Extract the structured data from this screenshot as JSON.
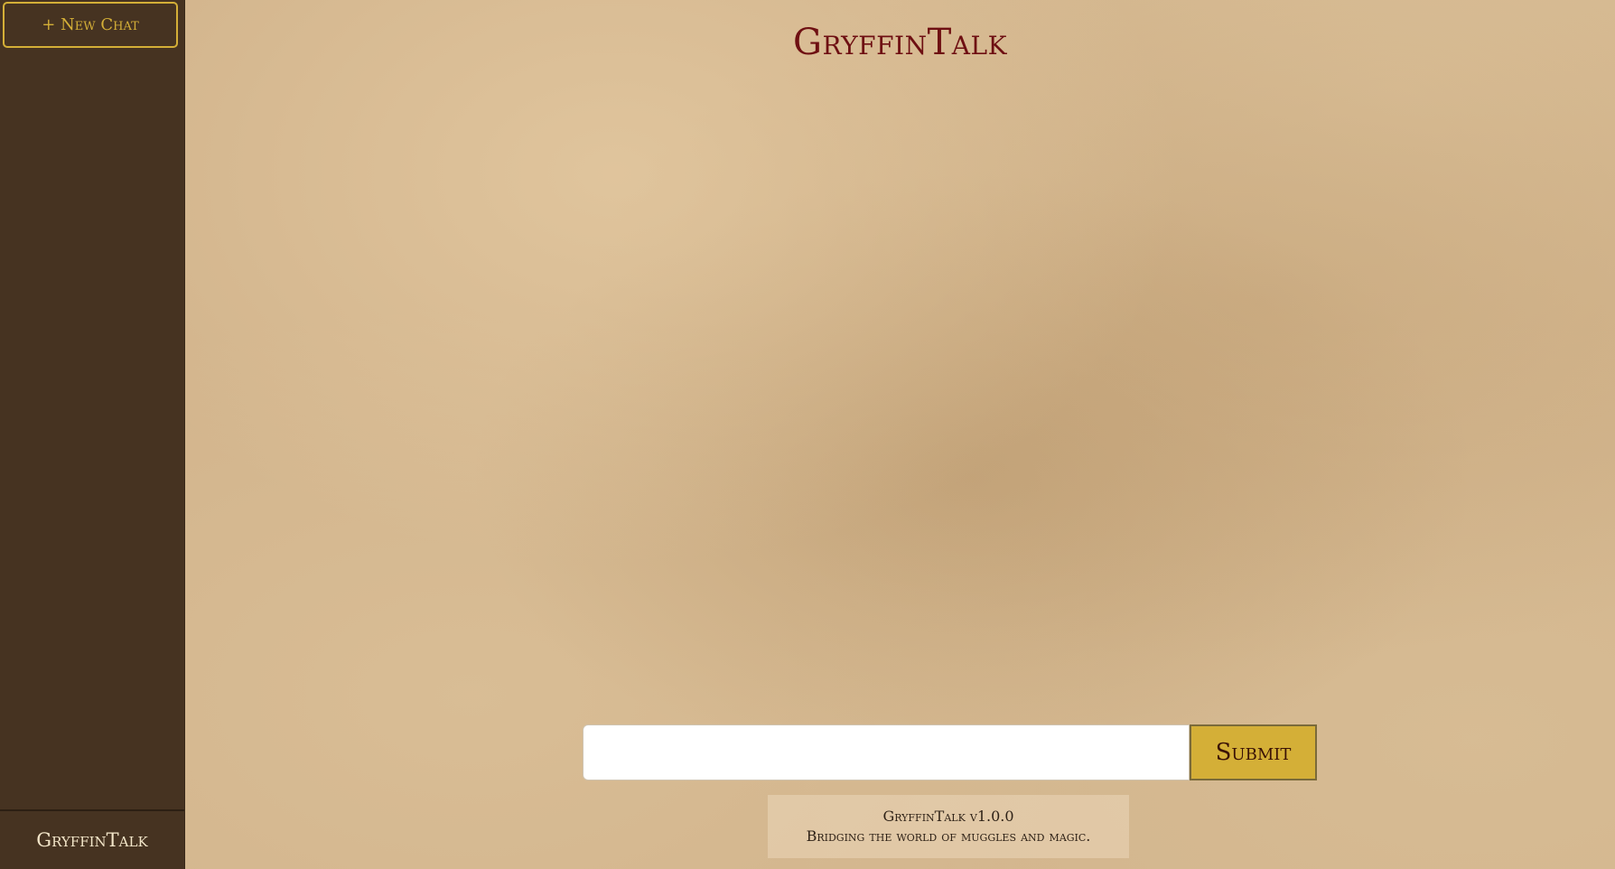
{
  "sidebar": {
    "new_chat_label": "+ New Chat",
    "footer_label": "GryffinTalk"
  },
  "main": {
    "title": "GryffinTalk",
    "input": {
      "value": "",
      "placeholder": ""
    },
    "submit_label": "Submit",
    "info": {
      "version": "GryffinTalk v1.0.0",
      "tagline": "Bridging the world of muggles and magic."
    }
  },
  "colors": {
    "sidebar_bg": "#463321",
    "accent_gold": "#d4af37",
    "title_crimson": "#6e0f12",
    "parchment": "#d2b48c"
  }
}
